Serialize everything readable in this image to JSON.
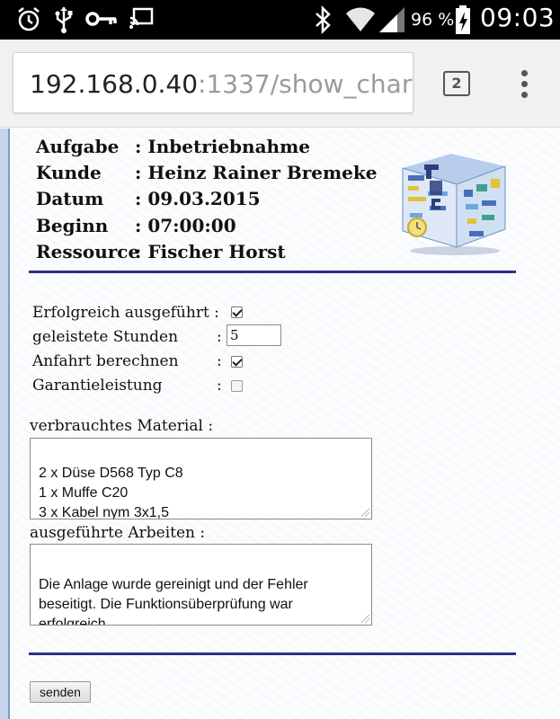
{
  "status_bar": {
    "icons": [
      "alarm-icon",
      "usb-icon",
      "key-icon",
      "screencast-icon",
      "bluetooth-icon",
      "wifi-icon",
      "signal-icon",
      "battery-charging-icon"
    ],
    "battery_percent": "96 %",
    "time": "09:03"
  },
  "browser": {
    "url_host": "192.168.0.40",
    "url_path": ":1337/show_char",
    "tab_count": "2",
    "menu_icon": "overflow-menu-icon"
  },
  "job": {
    "fields": [
      {
        "label": "Aufgabe",
        "value": ": Inbetriebnahme"
      },
      {
        "label": "Kunde",
        "value": ": Heinz Rainer Bremeke"
      },
      {
        "label": "Datum",
        "value": ": 09.03.2015"
      },
      {
        "label": "Beginn",
        "value": ": 07:00:00"
      },
      {
        "label": "Ressource",
        "value": ": Fischer Horst"
      }
    ]
  },
  "form": {
    "success_label": "Erfolgreich ausgeführt :",
    "success_checked": true,
    "hours_label": "geleistete Stunden",
    "hours_value": "5",
    "travel_label": "Anfahrt berechnen",
    "travel_checked": true,
    "warranty_label": "Garantieleistung",
    "warranty_checked": false,
    "colon": ":",
    "material_label": "verbrauchtes Material :",
    "material_text": "2 x Düse D568 Typ C8\n1 x Muffe C20\n3 x Kabel nym 3x1,5",
    "work_label": "ausgeführte Arbeiten :",
    "work_text": "Die Anlage wurde gereinigt und der Fehler\nbeseitigt. Die Funktionsüberprüfung war\nerfolgreich.",
    "submit_label": "senden"
  },
  "colors": {
    "rule": "#2d2f86",
    "page_background": "#fbfcfe",
    "left_stripe": "#c6d6ea"
  }
}
